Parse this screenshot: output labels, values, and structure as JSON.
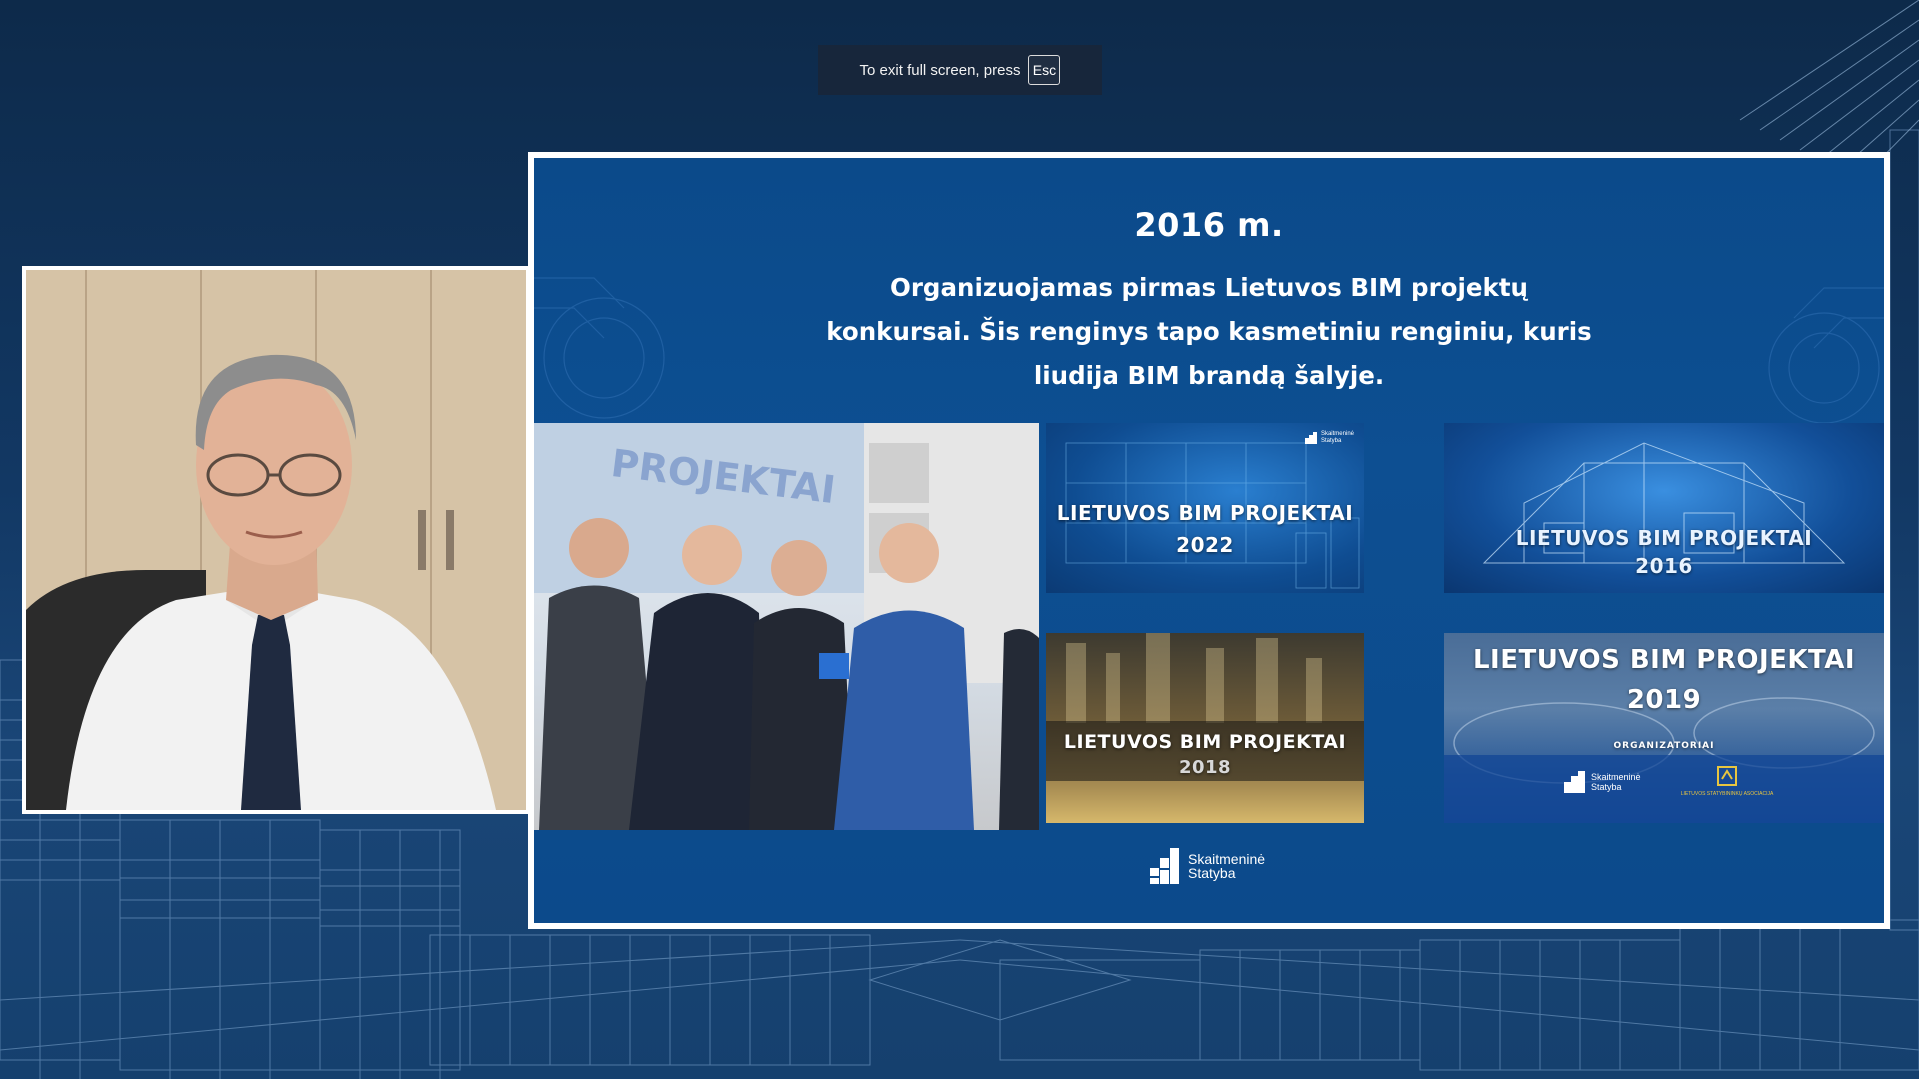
{
  "toast": {
    "message": "To exit full screen, press",
    "key": "Esc"
  },
  "slide": {
    "year": "2016 m.",
    "body_lines": [
      "Organizuojamas pirmas Lietuvos BIM projektų",
      "konkursai. Šis renginys tapo kasmetiniu renginiu, kuris",
      "liudija BIM brandą šalyje."
    ],
    "photo_banner": "PROJEKTAI",
    "tiles": [
      {
        "title": "LIETUVOS BIM PROJEKTAI",
        "year": "2022"
      },
      {
        "title": "LIETUVOS BIM PROJEKTAI",
        "year": "2016"
      },
      {
        "title": "LIETUVOS BIM PROJEKTAI",
        "year": "2018"
      },
      {
        "title": "LIETUVOS BIM PROJEKTAI",
        "year": "2019",
        "subtitle": "ORGANIZATORIAI"
      }
    ],
    "logo_line1": "Skaitmeninė",
    "logo_line2": "Statyba",
    "tile_logo_line1": "Skaitmeninė",
    "tile_logo_line2": "Statyba",
    "assoc_label": "LIETUVOS STATYBININKŲ ASOCIACIJA"
  },
  "colors": {
    "background": "#123864",
    "slide": "#0c4a8b",
    "frame": "#ffffff"
  }
}
